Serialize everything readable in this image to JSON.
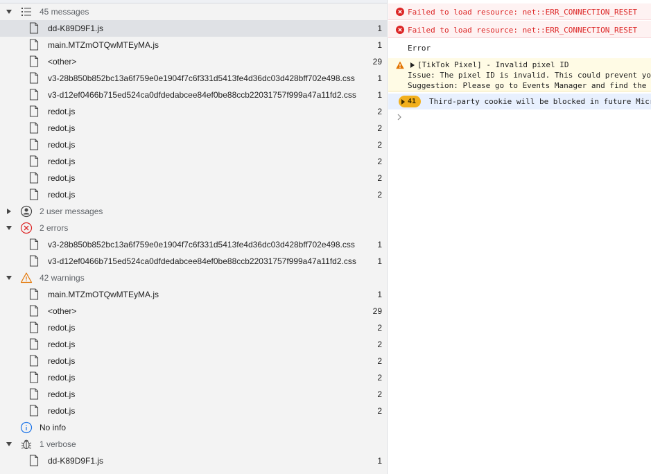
{
  "sidebar": {
    "groups": {
      "messages": {
        "label": "45 messages"
      },
      "user_messages": {
        "label": "2 user messages"
      },
      "errors": {
        "label": "2 errors"
      },
      "warnings": {
        "label": "42 warnings"
      },
      "info": {
        "label": "No info"
      },
      "verbose": {
        "label": "1 verbose"
      }
    },
    "messages_files": [
      {
        "name": "dd-K89D9F1.js",
        "count": "1"
      },
      {
        "name": "main.MTZmOTQwMTEyMA.js",
        "count": "1"
      },
      {
        "name": "<other>",
        "count": "29"
      },
      {
        "name": "v3-28b850b852bc13a6f759e0e1904f7c6f331d5413fe4d36dc03d428bff702e498.css",
        "count": "1"
      },
      {
        "name": "v3-d12ef0466b715ed524ca0dfdedabcee84ef0be88ccb22031757f999a47a11fd2.css",
        "count": "1"
      },
      {
        "name": "redot.js",
        "count": "2"
      },
      {
        "name": "redot.js",
        "count": "2"
      },
      {
        "name": "redot.js",
        "count": "2"
      },
      {
        "name": "redot.js",
        "count": "2"
      },
      {
        "name": "redot.js",
        "count": "2"
      },
      {
        "name": "redot.js",
        "count": "2"
      }
    ],
    "errors_files": [
      {
        "name": "v3-28b850b852bc13a6f759e0e1904f7c6f331d5413fe4d36dc03d428bff702e498.css",
        "count": "1"
      },
      {
        "name": "v3-d12ef0466b715ed524ca0dfdedabcee84ef0be88ccb22031757f999a47a11fd2.css",
        "count": "1"
      }
    ],
    "warnings_files": [
      {
        "name": "main.MTZmOTQwMTEyMA.js",
        "count": "1"
      },
      {
        "name": "<other>",
        "count": "29"
      },
      {
        "name": "redot.js",
        "count": "2"
      },
      {
        "name": "redot.js",
        "count": "2"
      },
      {
        "name": "redot.js",
        "count": "2"
      },
      {
        "name": "redot.js",
        "count": "2"
      },
      {
        "name": "redot.js",
        "count": "2"
      },
      {
        "name": "redot.js",
        "count": "2"
      }
    ],
    "verbose_files": [
      {
        "name": "dd-K89D9F1.js",
        "count": "1"
      }
    ]
  },
  "console": {
    "err1": "Failed to load resource: net::ERR_CONNECTION_RESET",
    "err2": "Failed to load resource: net::ERR_CONNECTION_RESET",
    "plain": "Error",
    "warn_line1": "[TikTok Pixel] - Invalid pixel ID",
    "warn_line2": "Issue: The pixel ID is invalid. This could prevent you",
    "warn_line3": "Suggestion: Please go to Events Manager and find the c",
    "badge_count": "41",
    "info": "Third-party cookie will be blocked in future Micr"
  },
  "colors": {
    "error": "#dc2626",
    "warning": "#e37400",
    "badge": "#f2b01e",
    "selected": "#dfe1e5"
  }
}
